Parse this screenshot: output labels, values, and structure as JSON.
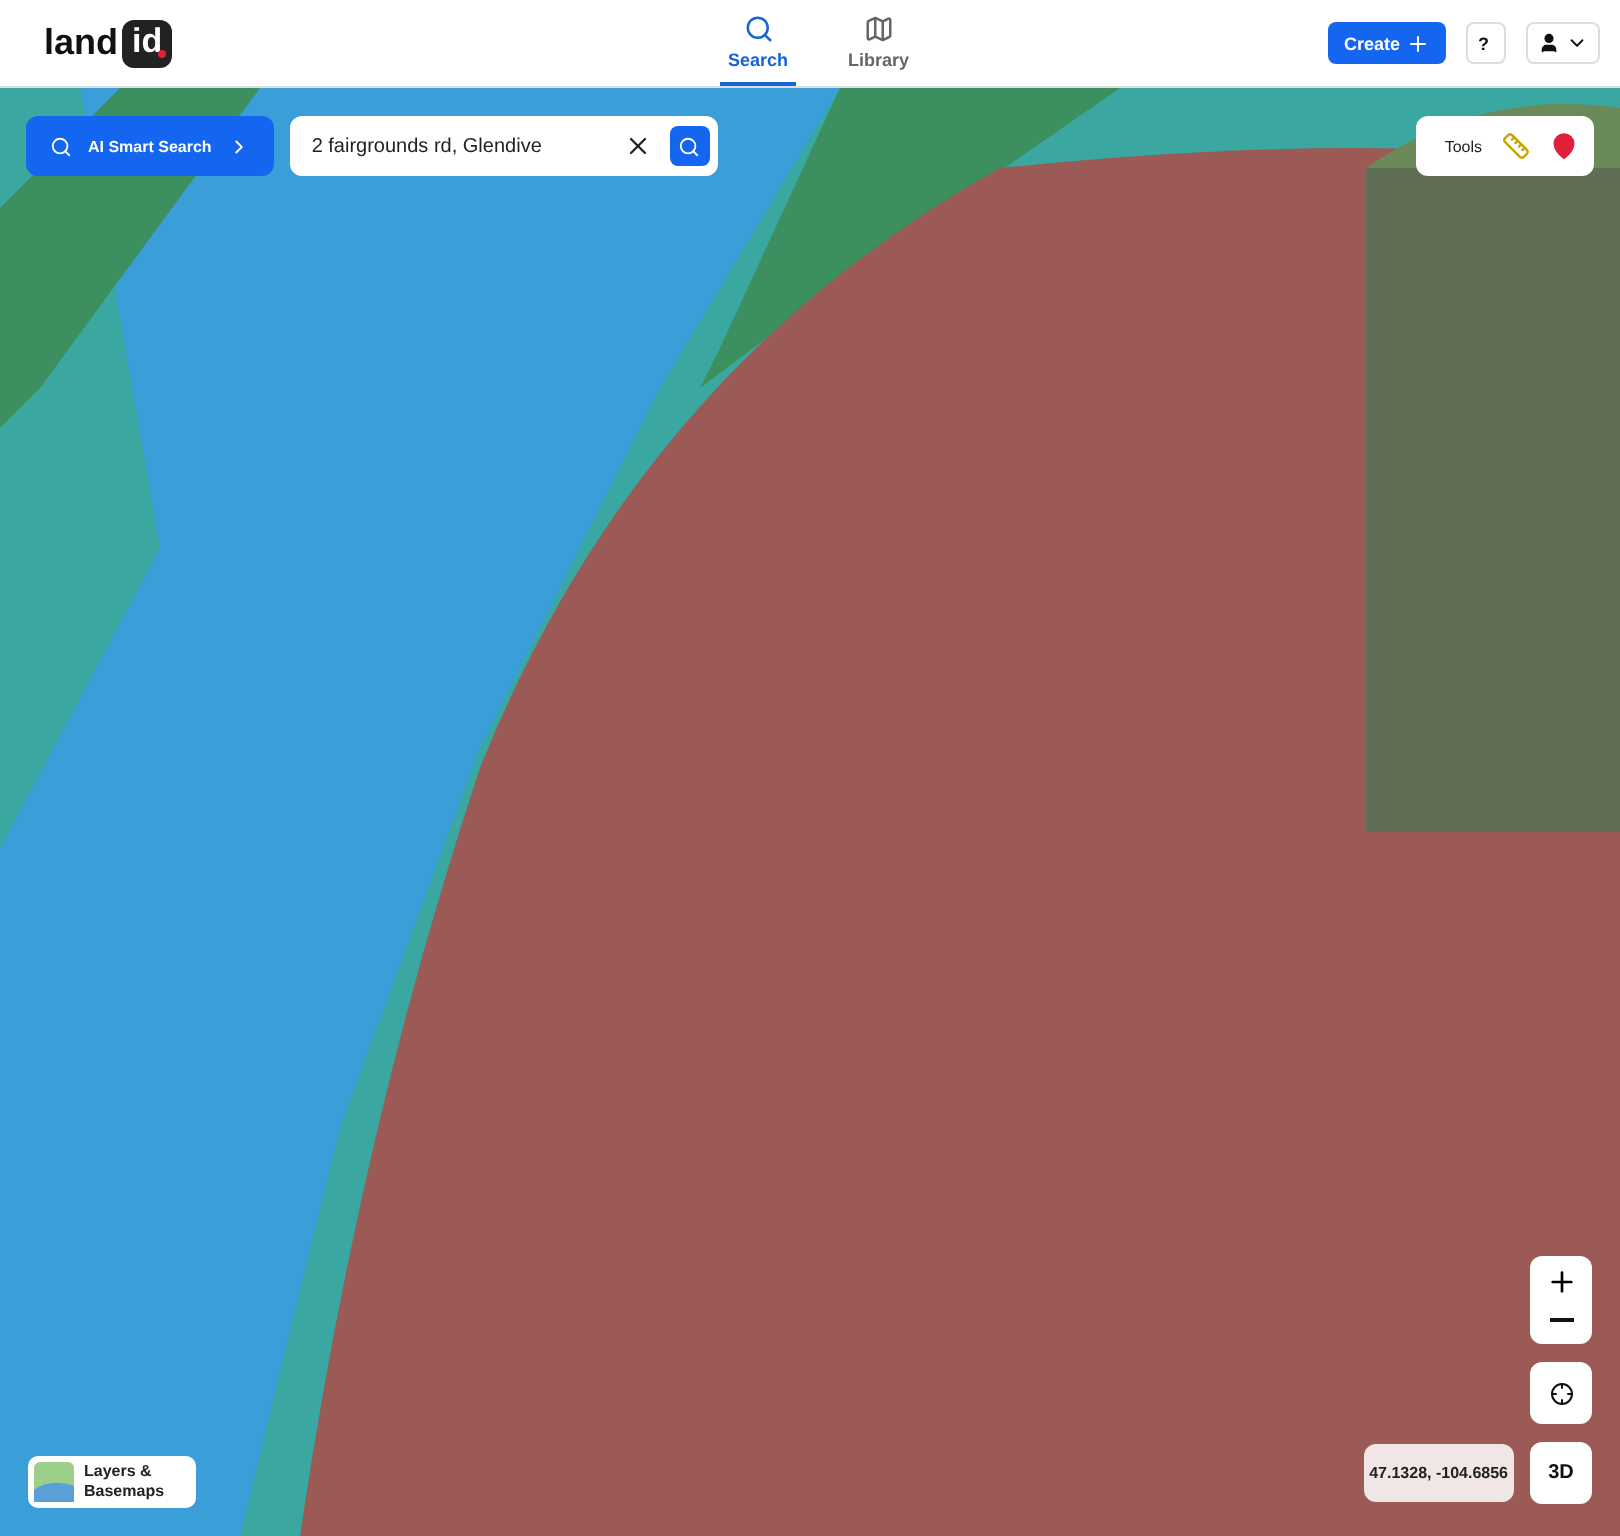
{
  "header": {
    "logo": {
      "word": "land",
      "badge": "id"
    },
    "nav": [
      {
        "label": "Search",
        "selected": true
      },
      {
        "label": "Library",
        "selected": false
      }
    ],
    "create_button": "Create",
    "help_button": "?"
  },
  "search_bar": {
    "ai_button": "AI Smart Search",
    "query": "2 fairgrounds rd, Glendive"
  },
  "tools": {
    "label": "Tools"
  },
  "map_controls": {
    "coordinates": "47.1328, -104.6856",
    "view_button": "3D"
  },
  "layers_button": "Layers & Basemaps"
}
